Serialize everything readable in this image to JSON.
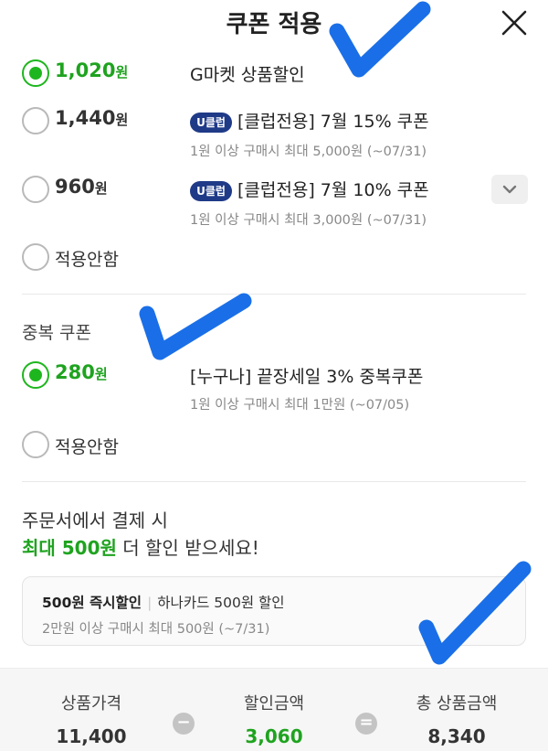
{
  "header": {
    "title": "쿠폰 적용"
  },
  "coupons": [
    {
      "amount": "1,020",
      "unit": "원",
      "checked": true,
      "name": "G마켓 상품할인",
      "badge": "",
      "desc": ""
    },
    {
      "amount": "1,440",
      "unit": "원",
      "checked": false,
      "name": "[클럽전용] 7월 15% 쿠폰",
      "badge": "U클럽",
      "desc": "1원 이상 구매시 최대 5,000원 (~07/31)"
    },
    {
      "amount": "960",
      "unit": "원",
      "checked": false,
      "name": "[클럽전용] 7월 10% 쿠폰",
      "badge": "U클럽",
      "desc": "1원 이상 구매시 최대 3,000원 (~07/31)"
    }
  ],
  "not_applied_label": "적용안함",
  "duplicate": {
    "section_title": "중복 쿠폰",
    "amount": "280",
    "unit": "원",
    "name": "[누구나] 끝장세일 3% 중복쿠폰",
    "desc": "1원 이상 구매시 최대 1만원 (~07/05)",
    "not_applied_label": "적용안함"
  },
  "promo": {
    "line1": "주문서에서 결제 시",
    "highlight": "최대 500원",
    "line2_rest": " 더 할인 받으세요!",
    "card_title": "500원 즉시할인",
    "card_sep": "|",
    "card_subtitle": "하나카드 500원 할인",
    "card_desc": "2만원 이상 구매시 최대 500원 (~7/31)"
  },
  "summary": {
    "price_label": "상품가격",
    "price_value": "11,400",
    "minus_symbol": "−",
    "discount_label": "할인금액",
    "discount_value": "3,060",
    "equals_symbol": "=",
    "total_label": "총 상품금액",
    "total_value": "8,340"
  },
  "colors": {
    "accent_green": "#1fa31f",
    "uclub_badge": "#1f3a87",
    "checkmark_blue": "#1a6fe8"
  },
  "icons": {
    "close": "close-icon",
    "expand": "chevron-down-icon",
    "annotation": "checkmark-icon"
  }
}
